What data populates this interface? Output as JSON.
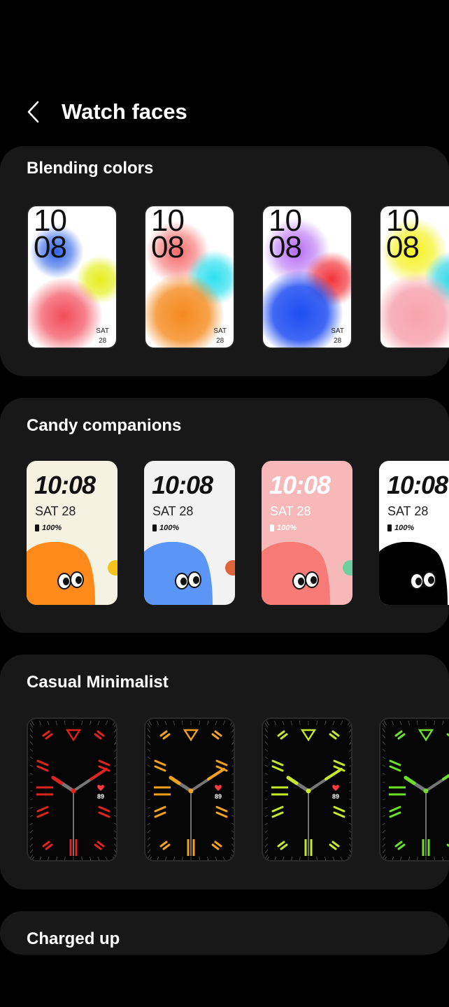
{
  "header": {
    "title": "Watch faces"
  },
  "sections": [
    {
      "title": "Blending colors",
      "faces": [
        {
          "hour": "10",
          "minute": "08",
          "day": "SAT",
          "date": "28"
        },
        {
          "hour": "10",
          "minute": "08",
          "day": "SAT",
          "date": "28"
        },
        {
          "hour": "10",
          "minute": "08",
          "day": "SAT",
          "date": "28"
        },
        {
          "hour": "10",
          "minute": "08"
        }
      ]
    },
    {
      "title": "Candy companions",
      "faces": [
        {
          "time": "10:08",
          "date": "SAT 28",
          "battery": "100%"
        },
        {
          "time": "10:08",
          "date": "SAT 28",
          "battery": "100%"
        },
        {
          "time": "10:08",
          "date": "SAT 28",
          "battery": "100%"
        },
        {
          "time": "10:08",
          "date": "SAT 28",
          "battery": "100%"
        }
      ]
    },
    {
      "title": "Casual Minimalist",
      "faces": [
        {
          "heart_rate": "89"
        },
        {
          "heart_rate": "89"
        },
        {
          "heart_rate": "89"
        },
        {}
      ]
    },
    {
      "title": "Charged up"
    }
  ],
  "colors": {
    "minimalist_accents": [
      "#e0231c",
      "#f2a21c",
      "#c6ea2a",
      "#6ee02a"
    ],
    "candy_backgrounds": [
      "#f5f2e2",
      "#f3f2f3",
      "#f6b8b8",
      "#ffffff"
    ],
    "candy_monsters": [
      "#ff8a1c",
      "#5b96f7",
      "#f77a76",
      "#000000"
    ],
    "candy_minis": [
      "#f6c31c",
      "#e0643a",
      "#6fcf9c",
      "#ffffff"
    ]
  },
  "icons": {
    "back": "chevron-left-icon",
    "battery": "battery-icon",
    "heart": "heart-icon"
  }
}
